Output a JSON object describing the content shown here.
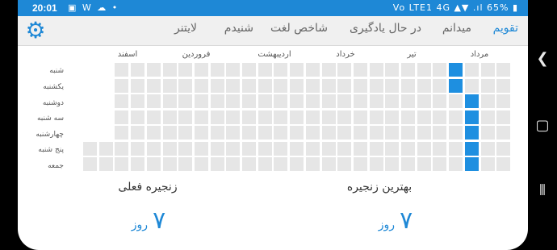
{
  "status_bar": {
    "time": "20:01",
    "notif_icons": "▣ W ☁ •",
    "right_icons": "Vo LTE1 4G ▲▼ .ıl 65% ▮"
  },
  "tabs": [
    {
      "label": "تقویم",
      "active": true
    },
    {
      "label": "میدانم",
      "active": false
    },
    {
      "label": "در حال یادگیری",
      "active": false
    },
    {
      "label": "شاخص لغت",
      "active": false
    },
    {
      "label": "شنیدم",
      "active": false
    },
    {
      "label": "لایتنر",
      "active": false
    }
  ],
  "months": [
    "مرداد",
    "تیر",
    "خرداد",
    "اردیبهشت",
    "فروردین",
    "اسفند"
  ],
  "days": [
    "شنبه",
    "یکشنبه",
    "دوشنبه",
    "سه شنبه",
    "چهارشنبه",
    "پنج شنبه",
    "جمعه"
  ],
  "grid": {
    "columns": 27,
    "empty_cells": [
      [
        0,
        0
      ],
      [
        1,
        0
      ],
      [
        2,
        0
      ],
      [
        3,
        0
      ],
      [
        4,
        0
      ],
      [
        0,
        1
      ],
      [
        1,
        1
      ],
      [
        2,
        1
      ],
      [
        3,
        1
      ],
      [
        4,
        1
      ]
    ],
    "active_cells": [
      [
        0,
        23
      ],
      [
        1,
        23
      ],
      [
        2,
        24
      ],
      [
        3,
        24
      ],
      [
        4,
        24
      ],
      [
        5,
        24
      ],
      [
        6,
        24
      ]
    ]
  },
  "stats": {
    "best_streak": {
      "label": "بهترین زنجیره",
      "value": "۷",
      "unit": "روز"
    },
    "current_streak": {
      "label": "زنجیره فعلی",
      "value": "۷",
      "unit": "روز"
    }
  },
  "colors": {
    "accent": "#1e88d6",
    "active_cell": "#1e8fe0",
    "inactive_cell": "#e6e6e6"
  }
}
